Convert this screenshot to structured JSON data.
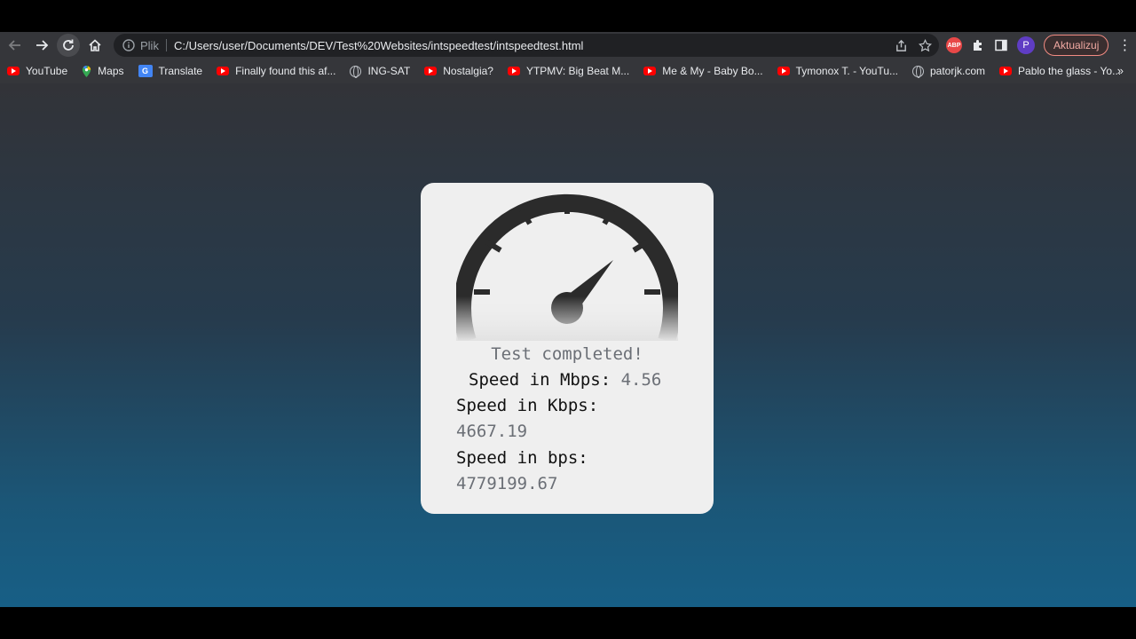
{
  "browser": {
    "file_label": "Plik",
    "url": "C:/Users/user/Documents/DEV/Test%20Websites/intspeedtest/intspeedtest.html",
    "update_label": "Aktualizuj",
    "avatar_letter": "P",
    "abp_label": "ABP",
    "accent": "#f28b82"
  },
  "bookmarks": [
    {
      "label": "YouTube",
      "icon": "youtube-icon"
    },
    {
      "label": "Maps",
      "icon": "maps-icon"
    },
    {
      "label": "Translate",
      "icon": "translate-icon"
    },
    {
      "label": "Finally found this af...",
      "icon": "youtube-icon"
    },
    {
      "label": "ING-SAT",
      "icon": "globe-icon"
    },
    {
      "label": "Nostalgia?",
      "icon": "youtube-icon"
    },
    {
      "label": "YTPMV: Big Beat M...",
      "icon": "youtube-icon"
    },
    {
      "label": "Me & My - Baby Bo...",
      "icon": "youtube-icon"
    },
    {
      "label": "Tymonox T. - YouTu...",
      "icon": "youtube-icon"
    },
    {
      "label": "patorjk.com",
      "icon": "globe-icon"
    },
    {
      "label": "Pablo the glass - Yo...",
      "icon": "youtube-icon"
    }
  ],
  "speedtest": {
    "status": "Test completed!",
    "mbps_label": "Speed in Mbps:",
    "mbps_value": "4.56",
    "kbps_label": "Speed in Kbps:",
    "kbps_value": "4667.19",
    "bps_label": "Speed in bps:",
    "bps_value": "4779199.67"
  }
}
